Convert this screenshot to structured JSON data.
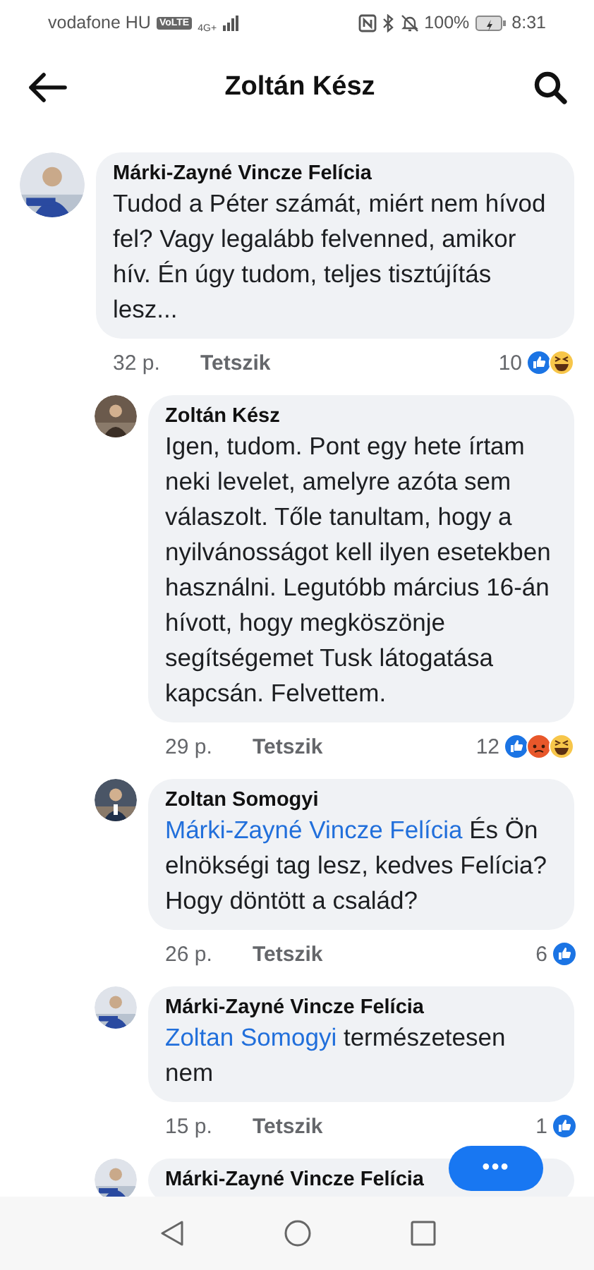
{
  "status_bar": {
    "carrier": "vodafone HU",
    "volte": "VoLTE",
    "network": "4G+",
    "battery": "100%",
    "time": "8:31"
  },
  "header": {
    "title": "Zoltán Kész"
  },
  "comments": [
    {
      "author": "Márki-Zayné Vincze Felícia",
      "reply": false,
      "body": [
        {
          "kind": "text",
          "text": "Tudod a Péter számát, miért nem hívod fel? Vagy legalább felvenned, amikor hív. Én úgy tudom, teljes tisztújítás lesz..."
        }
      ],
      "time": "32 p.",
      "like": "Tetszik",
      "count": "10",
      "reactions": [
        {
          "kind": "like"
        },
        {
          "kind": "haha"
        }
      ]
    },
    {
      "author": "Zoltán Kész",
      "reply": true,
      "body": [
        {
          "kind": "text",
          "text": "Igen, tudom. Pont egy hete írtam neki levelet, amelyre azóta sem válaszolt. Tőle tanultam, hogy a nyilvánosságot kell ilyen esetekben használni. Legutóbb március 16-án hívott, hogy megköszönje segítségemet Tusk látogatása kapcsán. Felvettem."
        }
      ],
      "time": "29 p.",
      "like": "Tetszik",
      "count": "12",
      "reactions": [
        {
          "kind": "like"
        },
        {
          "kind": "angry"
        },
        {
          "kind": "haha"
        }
      ]
    },
    {
      "author": "Zoltan Somogyi",
      "reply": true,
      "body": [
        {
          "kind": "mention",
          "text": "Márki-Zayné Vincze Felícia"
        },
        {
          "kind": "text",
          "text": " És Ön elnökségi tag lesz, kedves Felícia? Hogy döntött a család?"
        }
      ],
      "time": "26 p.",
      "like": "Tetszik",
      "count": "6",
      "reactions": [
        {
          "kind": "like"
        }
      ]
    },
    {
      "author": "Márki-Zayné Vincze Felícia",
      "reply": true,
      "body": [
        {
          "kind": "mention",
          "text": "Zoltan Somogyi"
        },
        {
          "kind": "text",
          "text": " természetesen nem"
        }
      ],
      "time": "15 p.",
      "like": "Tetszik",
      "count": "1",
      "reactions": [
        {
          "kind": "like"
        }
      ]
    },
    {
      "author": "Márki-Zayné Vincze Felícia",
      "reply": true
    }
  ],
  "more_button": {
    "label": "•••"
  }
}
